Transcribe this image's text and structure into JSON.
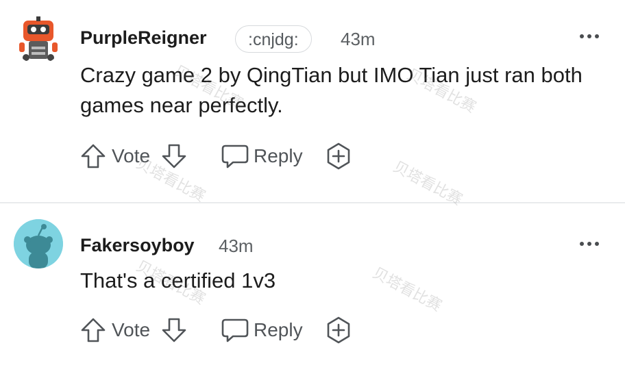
{
  "comments": [
    {
      "username": "PurpleReigner",
      "flair": ":cnjdg:",
      "time": "43m",
      "body": "Crazy game 2 by QingTian but IMO Tian just ran both games near perfectly.",
      "actions": {
        "vote": "Vote",
        "reply": "Reply"
      }
    },
    {
      "username": "Fakersoyboy",
      "time": "43m",
      "body": "That's a certified 1v3",
      "actions": {
        "vote": "Vote",
        "reply": "Reply"
      }
    }
  ],
  "watermark": "贝塔看比赛",
  "colors": {
    "avatar2_bg": "#7ed3e1",
    "avatar1_accent": "#e8572b"
  }
}
